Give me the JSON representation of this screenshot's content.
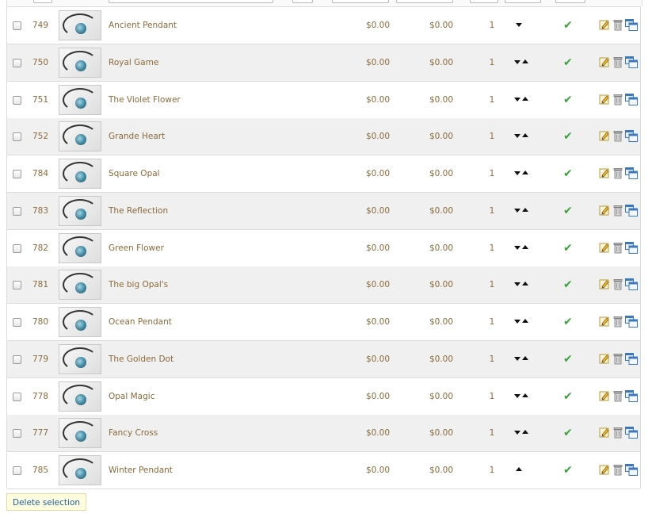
{
  "products": [
    {
      "id": "749",
      "name": "Ancient Pendant",
      "price": "$0.00",
      "final_price": "$0.00",
      "quantity": "1",
      "position": "first",
      "status": "active"
    },
    {
      "id": "750",
      "name": "Royal Game",
      "price": "$0.00",
      "final_price": "$0.00",
      "quantity": "1",
      "position": "middle",
      "status": "active"
    },
    {
      "id": "751",
      "name": "The Violet Flower",
      "price": "$0.00",
      "final_price": "$0.00",
      "quantity": "1",
      "position": "middle",
      "status": "active"
    },
    {
      "id": "752",
      "name": "Grande Heart",
      "price": "$0.00",
      "final_price": "$0.00",
      "quantity": "1",
      "position": "middle",
      "status": "active"
    },
    {
      "id": "784",
      "name": "Square Opal",
      "price": "$0.00",
      "final_price": "$0.00",
      "quantity": "1",
      "position": "middle",
      "status": "active"
    },
    {
      "id": "783",
      "name": "The Reflection",
      "price": "$0.00",
      "final_price": "$0.00",
      "quantity": "1",
      "position": "middle",
      "status": "active"
    },
    {
      "id": "782",
      "name": "Green Flower",
      "price": "$0.00",
      "final_price": "$0.00",
      "quantity": "1",
      "position": "middle",
      "status": "active"
    },
    {
      "id": "781",
      "name": "The big Opal's",
      "price": "$0.00",
      "final_price": "$0.00",
      "quantity": "1",
      "position": "middle",
      "status": "active"
    },
    {
      "id": "780",
      "name": "Ocean Pendant",
      "price": "$0.00",
      "final_price": "$0.00",
      "quantity": "1",
      "position": "middle",
      "status": "active"
    },
    {
      "id": "779",
      "name": "The Golden Dot",
      "price": "$0.00",
      "final_price": "$0.00",
      "quantity": "1",
      "position": "middle",
      "status": "active"
    },
    {
      "id": "778",
      "name": "Opal Magic",
      "price": "$0.00",
      "final_price": "$0.00",
      "quantity": "1",
      "position": "middle",
      "status": "active"
    },
    {
      "id": "777",
      "name": "Fancy Cross",
      "price": "$0.00",
      "final_price": "$0.00",
      "quantity": "1",
      "position": "middle",
      "status": "active"
    },
    {
      "id": "785",
      "name": "Winter Pendant",
      "price": "$0.00",
      "final_price": "$0.00",
      "quantity": "1",
      "position": "last",
      "status": "active"
    }
  ],
  "footer": {
    "delete_selection_label": "Delete selection"
  },
  "icons": {
    "move_down": "arrow-down-icon",
    "move_up": "arrow-up-icon",
    "status": "check-icon",
    "edit": "edit-icon",
    "delete": "trash-icon",
    "duplicate": "duplicate-icon"
  },
  "colors": {
    "text": "#8a6a3a",
    "row_alt": "#f0f0f0",
    "status_active": "#3aa33a",
    "button_bg": "#fffde0",
    "button_text": "#1f5f9b"
  }
}
